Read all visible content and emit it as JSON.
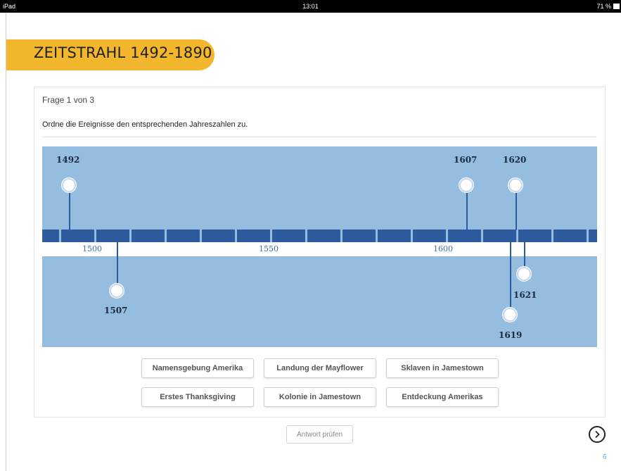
{
  "status_bar": {
    "device": "iPad",
    "time": "13:01",
    "battery": "71 %"
  },
  "header": {
    "title": "ZEITSTRAHL 1492-1890"
  },
  "question": {
    "counter": "Frage 1 von 3",
    "instruction": "Ordne die Ereignisse den entsprechenden Jahreszahlen zu."
  },
  "timeline": {
    "axis_labels": [
      "1500",
      "1550",
      "1600"
    ],
    "markers_above": [
      "1492",
      "1607",
      "1620"
    ],
    "markers_below": [
      "1507",
      "1619",
      "1621"
    ]
  },
  "answer_chips": [
    "Namensgebung Amerika",
    "Landung der Mayflower",
    "Sklaven in Jamestown",
    "Erstes Thanksgiving",
    "Kolonie in Jamestown",
    "Entdeckung Amerikas"
  ],
  "footer": {
    "check_button": "Antwort prüfen",
    "page_number": "6",
    "next_icon": "chevron-right-icon"
  },
  "colors": {
    "banner": "#f3b72e",
    "timeline_bg": "#94bde0",
    "timeline_band": "#2d5b9e"
  }
}
